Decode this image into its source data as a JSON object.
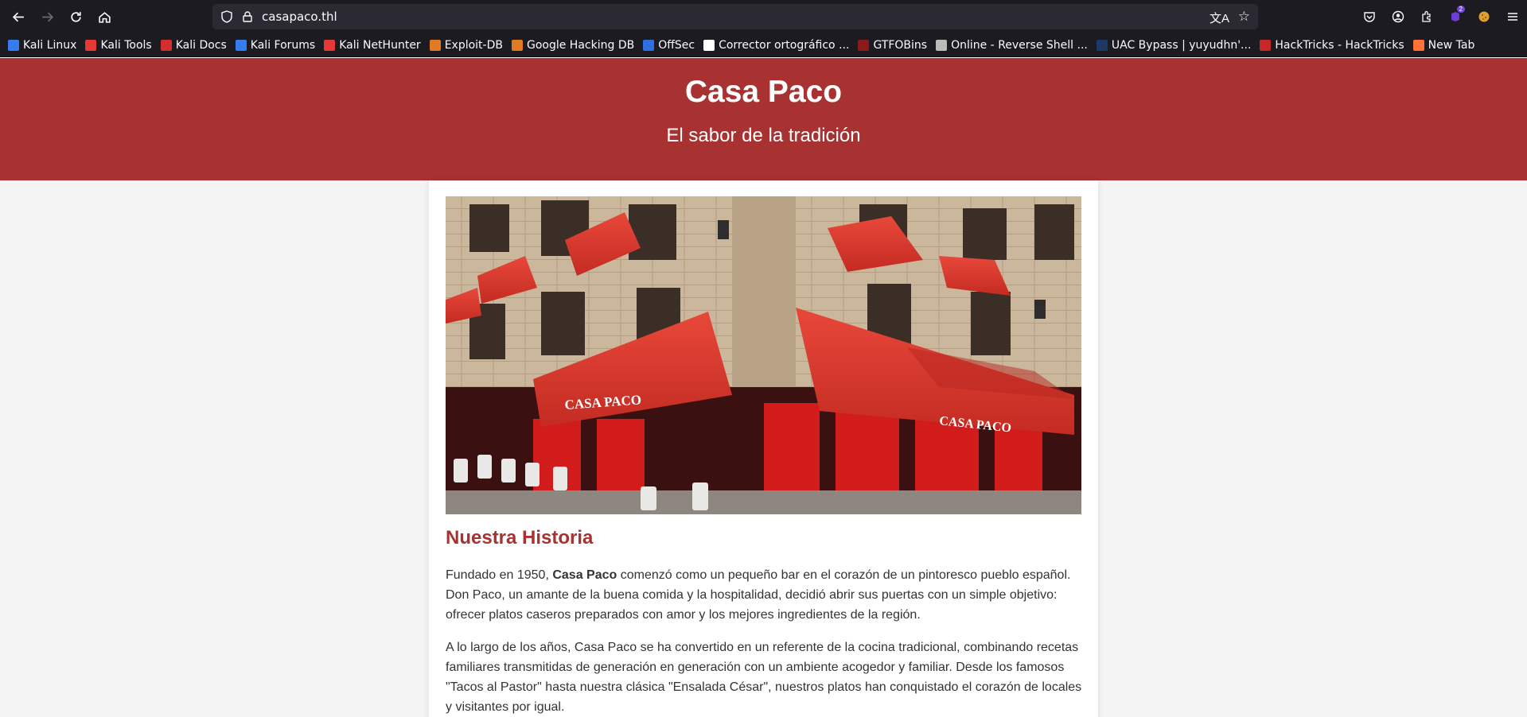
{
  "browser": {
    "url": "casapaco.thl",
    "bookmarks": [
      {
        "label": "Kali Linux",
        "color": "#367bf0"
      },
      {
        "label": "Kali Tools",
        "color": "#e53935"
      },
      {
        "label": "Kali Docs",
        "color": "#d32f2f"
      },
      {
        "label": "Kali Forums",
        "color": "#367bf0"
      },
      {
        "label": "Kali NetHunter",
        "color": "#e53935"
      },
      {
        "label": "Exploit-DB",
        "color": "#e07a24"
      },
      {
        "label": "Google Hacking DB",
        "color": "#e07a24"
      },
      {
        "label": "OffSec",
        "color": "#2f6fe0"
      },
      {
        "label": "Corrector ortográfico ...",
        "color": "#ffffff"
      },
      {
        "label": "GTFOBins",
        "color": "#8b1a1a"
      },
      {
        "label": "Online - Reverse Shell ...",
        "color": "#bbbbbb"
      },
      {
        "label": "UAC Bypass | yuyudhn'...",
        "color": "#1d3a66"
      },
      {
        "label": "HackTricks - HackTricks",
        "color": "#c62828"
      },
      {
        "label": "New Tab",
        "color": "#ff7139"
      }
    ],
    "extension_badge": "2"
  },
  "site": {
    "title": "Casa Paco",
    "tagline": "El sabor de la tradición",
    "awning_text": "CASA PACO",
    "history_heading": "Nuestra Historia",
    "p1_before": "Fundado en 1950, ",
    "p1_bold": "Casa Paco",
    "p1_after": " comenzó como un pequeño bar en el corazón de un pintoresco pueblo español. Don Paco, un amante de la buena comida y la hospitalidad, decidió abrir sus puertas con un simple objetivo: ofrecer platos caseros preparados con amor y los mejores ingredientes de la región.",
    "p2": "A lo largo de los años, Casa Paco se ha convertido en un referente de la cocina tradicional, combinando recetas familiares transmitidas de generación en generación con un ambiente acogedor y familiar. Desde los famosos \"Tacos al Pastor\" hasta nuestra clásica \"Ensalada César\", nuestros platos han conquistado el corazón de locales y visitantes por igual."
  },
  "colors": {
    "brand_red": "#a83232",
    "chrome_bg": "#1c1b22",
    "urlbar_bg": "#2b2a33"
  }
}
